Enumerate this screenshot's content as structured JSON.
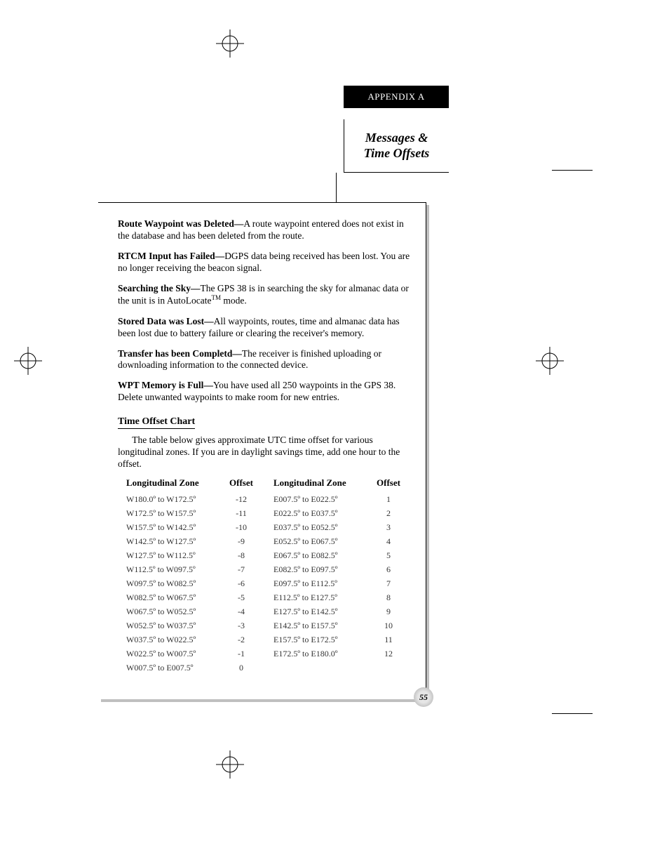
{
  "appendix": "APPENDIX A",
  "section": {
    "line1": "Messages &",
    "line2": "Time Offsets"
  },
  "messages": [
    {
      "bold": "Route Waypoint was Deleted—",
      "text": "A route waypoint entered does not exist in the database and has been deleted from the route."
    },
    {
      "bold": "RTCM Input has Failed—",
      "text": "DGPS data being received has been lost. You are no longer receiving the beacon signal."
    },
    {
      "bold": "Searching the Sky—",
      "text": "The GPS 38 is in searching the sky for almanac data or the unit is in AutoLocate",
      "super": "TM",
      "text2": " mode."
    },
    {
      "bold": "Stored Data was Lost—",
      "text": "All waypoints, routes, time and almanac data has been lost due to battery failure or clearing the receiver's memory."
    },
    {
      "bold": "Transfer has been Completd—",
      "text": "The receiver is finished uploading or downloading information to the connected device."
    },
    {
      "bold": "WPT Memory is Full—",
      "text": "You have used all 250 waypoints in the GPS 38. Delete unwanted waypoints to make room for new entries."
    }
  ],
  "chart": {
    "heading": "Time Offset Chart",
    "intro": "The table below gives approximate UTC time offset for various longitudinal zones. If you are in daylight savings time, add one hour to the offset.",
    "headers": {
      "zone": "Longitudinal Zone",
      "offset": "Offset"
    },
    "left": [
      {
        "zone": "W180.0º to W172.5º",
        "offset": "-12"
      },
      {
        "zone": "W172.5º to W157.5º",
        "offset": "-11"
      },
      {
        "zone": "W157.5º to W142.5º",
        "offset": "-10"
      },
      {
        "zone": "W142.5º to W127.5º",
        "offset": "-9"
      },
      {
        "zone": "W127.5º to W112.5º",
        "offset": "-8"
      },
      {
        "zone": "W112.5º to W097.5º",
        "offset": "-7"
      },
      {
        "zone": "W097.5º to W082.5º",
        "offset": "-6"
      },
      {
        "zone": "W082.5º to W067.5º",
        "offset": "-5"
      },
      {
        "zone": "W067.5º to W052.5º",
        "offset": "-4"
      },
      {
        "zone": "W052.5º to W037.5º",
        "offset": "-3"
      },
      {
        "zone": "W037.5º to W022.5º",
        "offset": "-2"
      },
      {
        "zone": "W022.5º to W007.5º",
        "offset": "-1"
      },
      {
        "zone": "W007.5º to E007.5º",
        "offset": "0"
      }
    ],
    "right": [
      {
        "zone": "E007.5º to E022.5º",
        "offset": "1"
      },
      {
        "zone": "E022.5º to E037.5º",
        "offset": "2"
      },
      {
        "zone": "E037.5º to E052.5º",
        "offset": "3"
      },
      {
        "zone": "E052.5º to E067.5º",
        "offset": "4"
      },
      {
        "zone": "E067.5º to E082.5º",
        "offset": "5"
      },
      {
        "zone": "E082.5º to E097.5º",
        "offset": "6"
      },
      {
        "zone": "E097.5º to E112.5º",
        "offset": "7"
      },
      {
        "zone": "E112.5º to E127.5º",
        "offset": "8"
      },
      {
        "zone": "E127.5º to E142.5º",
        "offset": "9"
      },
      {
        "zone": "E142.5º to E157.5º",
        "offset": "10"
      },
      {
        "zone": "E157.5º to E172.5º",
        "offset": "11"
      },
      {
        "zone": "E172.5º to E180.0º",
        "offset": "12"
      }
    ]
  },
  "page_number": "55",
  "chart_data": {
    "type": "table",
    "title": "Time Offset Chart",
    "columns": [
      "Longitudinal Zone",
      "Offset"
    ],
    "rows": [
      [
        "W180.0º to W172.5º",
        -12
      ],
      [
        "W172.5º to W157.5º",
        -11
      ],
      [
        "W157.5º to W142.5º",
        -10
      ],
      [
        "W142.5º to W127.5º",
        -9
      ],
      [
        "W127.5º to W112.5º",
        -8
      ],
      [
        "W112.5º to W097.5º",
        -7
      ],
      [
        "W097.5º to W082.5º",
        -6
      ],
      [
        "W082.5º to W067.5º",
        -5
      ],
      [
        "W067.5º to W052.5º",
        -4
      ],
      [
        "W052.5º to W037.5º",
        -3
      ],
      [
        "W037.5º to W022.5º",
        -2
      ],
      [
        "W022.5º to W007.5º",
        -1
      ],
      [
        "W007.5º to E007.5º",
        0
      ],
      [
        "E007.5º to E022.5º",
        1
      ],
      [
        "E022.5º to E037.5º",
        2
      ],
      [
        "E037.5º to E052.5º",
        3
      ],
      [
        "E052.5º to E067.5º",
        4
      ],
      [
        "E067.5º to E082.5º",
        5
      ],
      [
        "E082.5º to E097.5º",
        6
      ],
      [
        "E097.5º to E112.5º",
        7
      ],
      [
        "E112.5º to E127.5º",
        8
      ],
      [
        "E127.5º to E142.5º",
        9
      ],
      [
        "E142.5º to E157.5º",
        10
      ],
      [
        "E157.5º to E172.5º",
        11
      ],
      [
        "E172.5º to E180.0º",
        12
      ]
    ]
  }
}
